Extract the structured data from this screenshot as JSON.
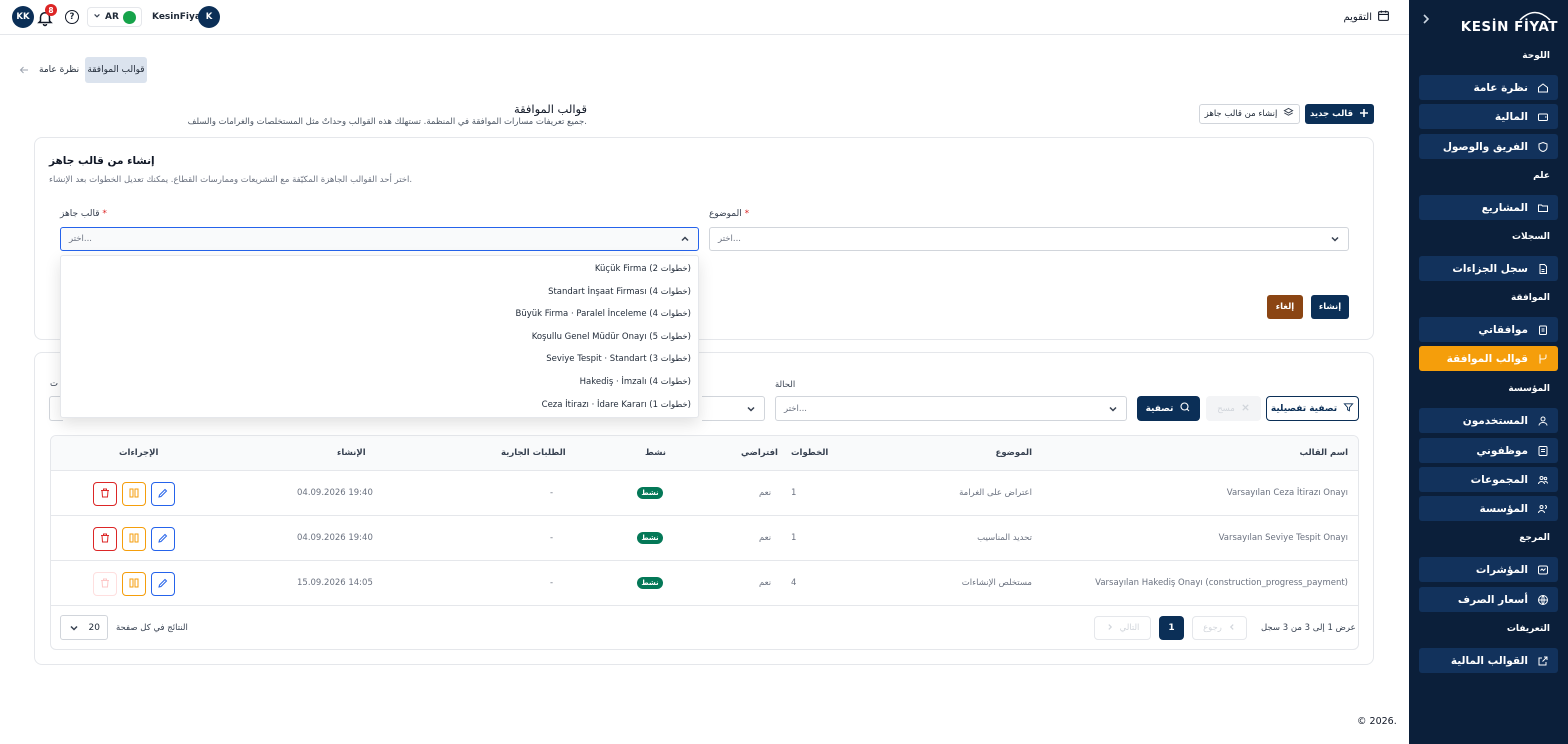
{
  "sidebar": {
    "logo": "KESİN FİYAT",
    "sections": {
      "dashboard": "اللوحة",
      "general": "علم",
      "records": "السجلات",
      "approval": "الموافقة",
      "organization": "المؤسسة",
      "reference": "المرجع",
      "definitions": "التعريفات"
    },
    "items": {
      "overview": "نظرة عامة",
      "finance": "المالية",
      "team": "الفريق والوصول",
      "projects": "المشاريع",
      "penalties": "سجل الجزاءات",
      "my_approvals": "موافقاتي",
      "approval_templates": "قوالب الموافقة",
      "users": "المستخدمون",
      "employees": "موظفوني",
      "groups": "المجموعات",
      "organization": "المؤسسة",
      "indicators": "المؤشرات",
      "exchange_rates": "أسعار الصرف",
      "financial_templates": "القوالب المالية"
    }
  },
  "topbar": {
    "avatar_initials": "KK",
    "notification_count": "8",
    "help_glyph": "?",
    "language": "AR",
    "user_name": "KesinFiyat",
    "user_initial": "K",
    "calendar_label": "التقويم"
  },
  "breadcrumb": {
    "overview": "نظرة عامة",
    "current": "قوالب الموافقة"
  },
  "header": {
    "title": "قوالب الموافقة",
    "subtitle": "جميع تعريفات مسارات الموافقة في المنظمة. تستهلك هذه القوالب وحداتٌ مثل المستخلصات والغرامات والسلف.",
    "new_template": "قالب جديد",
    "from_ready": "إنشاء من قالب جاهز"
  },
  "create_panel": {
    "title": "إنشاء من قالب جاهز",
    "subtitle": "اختر أحد القوالب الجاهزة المكيّفة مع التشريعات وممارسات القطاع. يمكنك تعديل الخطوات بعد الإنشاء.",
    "template_label": "قالب جاهز",
    "template_placeholder": "اختر...",
    "subject_label": "الموضوع",
    "subject_placeholder": "اختر...",
    "required_mark": "*",
    "cancel": "إلغاء",
    "create": "إنشاء"
  },
  "dropdown_options": [
    "Küçük Firma (2 خطوات)",
    "Standart İnşaat Firması (4 خطوات)",
    "Büyük Firma · Paralel İnceleme (4 خطوات)",
    "Koşullu Genel Müdür Onayı (5 خطوات)",
    "Seviye Tespit · Standart (3 خطوات)",
    "Hakediş · İmzalı (4 خطوات)",
    "Ceza İtirazı · İdare Kararı (1 خطوات)"
  ],
  "filters": {
    "status_label": "الحالة",
    "status_placeholder": "اختر...",
    "cut_label": "ت",
    "advanced": "تصفية تفصيلية",
    "clear": "مسح",
    "filter": "تصفية"
  },
  "table": {
    "headers": {
      "name": "اسم القالب",
      "subject": "الموضوع",
      "steps": "الخطوات",
      "default": "افتراضي",
      "active": "نشط",
      "pending": "الطلبات الجارية",
      "created": "الإنشاء",
      "actions": "الإجراءات"
    },
    "rows": [
      {
        "name": "Varsayılan Ceza İtirazı Onayı",
        "subject": "اعتراض على الغرامة",
        "steps": "1",
        "default": "نعم",
        "active": "نشط",
        "pending": "-",
        "created": "04.09.2026 19:40"
      },
      {
        "name": "Varsayılan Seviye Tespit Onayı",
        "subject": "تحديد المناسيب",
        "steps": "1",
        "default": "نعم",
        "active": "نشط",
        "pending": "-",
        "created": "04.09.2026 19:40"
      },
      {
        "name": "Varsayılan Hakediş Onayı (construction_progress_payment)",
        "subject": "مستخلص الإنشاءات",
        "steps": "4",
        "default": "نعم",
        "active": "نشط",
        "pending": "-",
        "created": "15.09.2026 14:05"
      }
    ]
  },
  "pagination": {
    "info": "عرض 1 إلى 3 من 3 سجل",
    "prev": "رجوع",
    "next": "التالي",
    "current": "1",
    "per_page_value": "20",
    "per_page_label": "النتائج في كل صفحة"
  },
  "footer": "© 2026."
}
